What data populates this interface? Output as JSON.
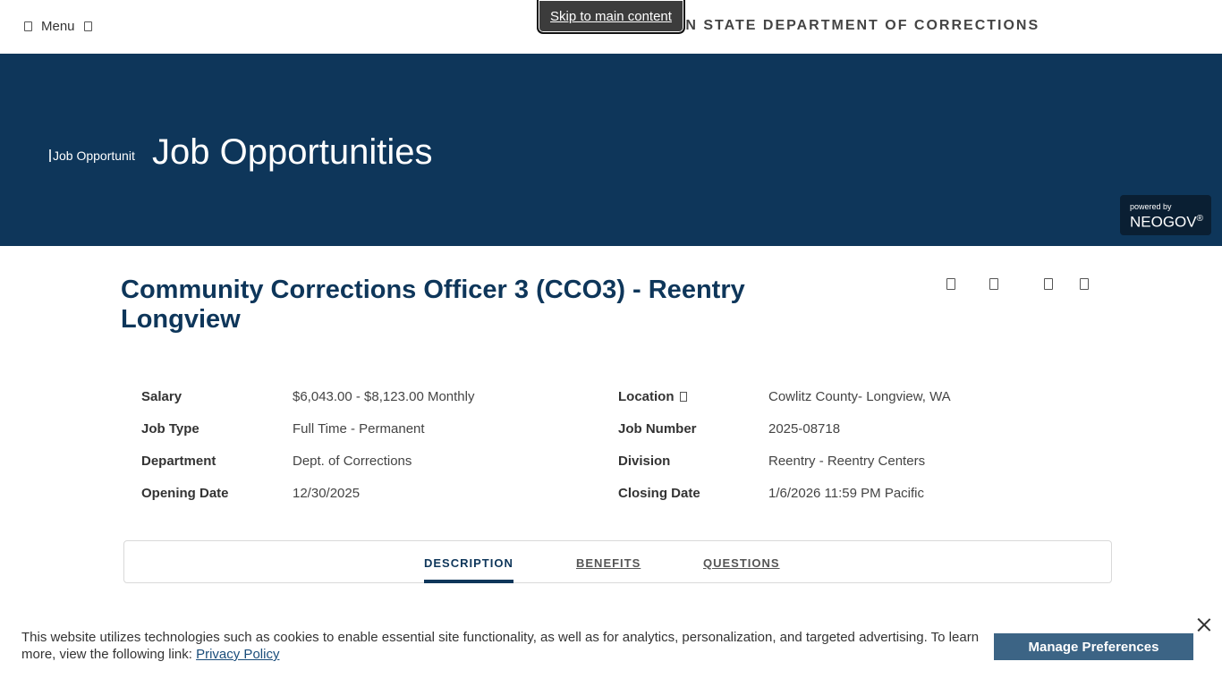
{
  "header": {
    "menu_label": "Menu",
    "org_title": "WASHINGTON STATE DEPARTMENT OF CORRECTIONS",
    "skip_link": "Skip to main content"
  },
  "hero": {
    "logo_alt": "Job Opportunities",
    "title": "Job Opportunities",
    "powered_by": "powered by",
    "brand": "NEOGOV",
    "brand_mark": "®",
    "background_color": "#0e365a"
  },
  "job": {
    "title": "Community Corrections Officer 3 (CCO3) - Reentry Longview",
    "action_icons": [
      "print-icon",
      "email-icon",
      "facebook-icon",
      "share-icon"
    ]
  },
  "details": {
    "rows": [
      {
        "label": "Salary",
        "value": "$6,043.00 - $8,123.00 Monthly",
        "label2": "Location",
        "value2": "Cowlitz County- Longview, WA"
      },
      {
        "label": "Job Type",
        "value": "Full Time - Permanent",
        "label2": "Job Number",
        "value2": "2025-08718"
      },
      {
        "label": "Department",
        "value": "Dept. of Corrections",
        "label2": "Division",
        "value2": "Reentry - Reentry Centers"
      },
      {
        "label": "Opening Date",
        "value": "12/30/2025",
        "label2": "Closing Date",
        "value2": "1/6/2026 11:59 PM Pacific"
      }
    ]
  },
  "tabs": {
    "items": [
      {
        "label": "DESCRIPTION",
        "active": true
      },
      {
        "label": "BENEFITS",
        "active": false
      },
      {
        "label": "QUESTIONS",
        "active": false
      }
    ]
  },
  "cookie": {
    "text": "This website utilizes technologies such as cookies to enable essential site functionality, as well as for analytics, personalization, and targeted advertising. To learn more, view the following link: ",
    "link_label": "Privacy Policy",
    "button_label": "Manage Preferences",
    "button_color": "#3c6485"
  }
}
